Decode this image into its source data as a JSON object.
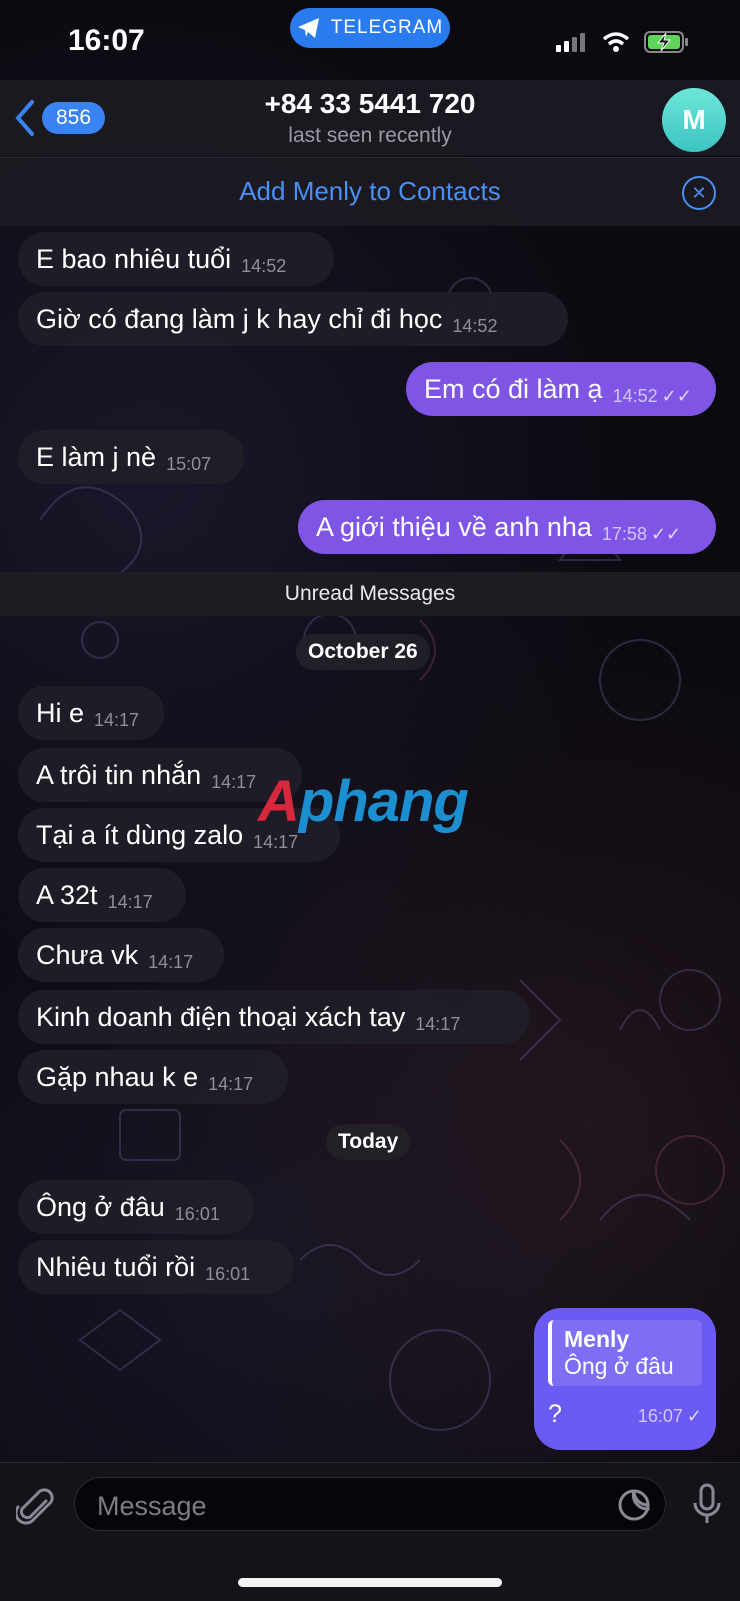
{
  "status_bar": {
    "time": "16:07",
    "app_pill": "TELEGRAM"
  },
  "header": {
    "back_count": "856",
    "title": "+84 33 5441 720",
    "subtitle": "last seen recently",
    "avatar_initial": "M"
  },
  "contact_banner": {
    "label": "Add Menly to Contacts"
  },
  "messages": [
    {
      "text": "E bao nhiêu tuổi",
      "time": "14:52"
    },
    {
      "text": "Giờ có đang làm j k hay chỉ đi học",
      "time": "14:52"
    },
    {
      "text": "Em có đi làm ạ",
      "time": "14:52"
    },
    {
      "text": "E làm j nè",
      "time": "15:07"
    },
    {
      "text": "A giới thiệu về anh nha",
      "time": "17:58"
    },
    {
      "text": "Hi e",
      "time": "14:17"
    },
    {
      "text": "A trôi tin nhắn",
      "time": "14:17"
    },
    {
      "text": "Tại a ít dùng zalo",
      "time": "14:17"
    },
    {
      "text": "A 32t",
      "time": "14:17"
    },
    {
      "text": "Chưa vk",
      "time": "14:17"
    },
    {
      "text": "Kinh doanh điện thoại xách tay",
      "time": "14:17"
    },
    {
      "text": "Gặp nhau k e",
      "time": "14:17"
    },
    {
      "text": "Ông ở đâu",
      "time": "16:01"
    },
    {
      "text": "Nhiêu tuổi rồi",
      "time": "16:01"
    }
  ],
  "unread_label": "Unread Messages",
  "date_labels": {
    "first": "October 26",
    "second": "Today"
  },
  "reply_message": {
    "quote_name": "Menly",
    "quote_text": "Ông ở đâu",
    "text": "?",
    "time": "16:07"
  },
  "watermark": {
    "part1": "A",
    "part2": "phang"
  },
  "input": {
    "placeholder": "Message"
  },
  "colors": {
    "accent": "#3a83f2",
    "outgoing_bubble": "#7f55e6",
    "reply_bubble": "#6b5bf2"
  }
}
